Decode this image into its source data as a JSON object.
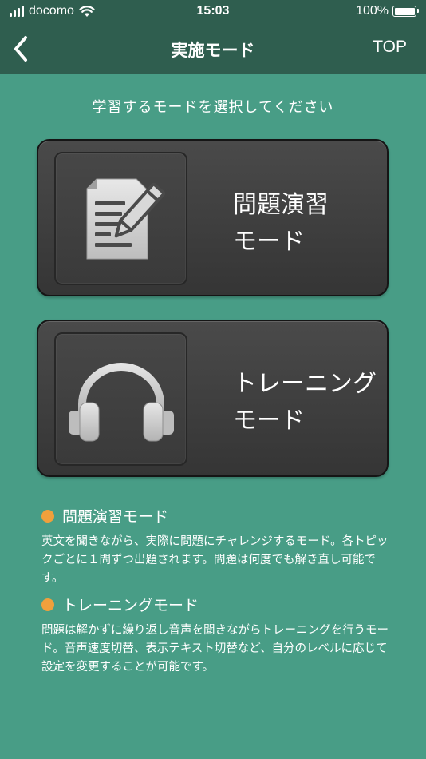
{
  "status_bar": {
    "carrier": "docomo",
    "time": "15:03",
    "battery_percent": "100%",
    "battery_level": 1.0
  },
  "nav": {
    "back_icon": "chevron-left-icon",
    "title": "実施モード",
    "top_label": "TOP"
  },
  "instruction": "学習するモードを選択してください",
  "modes": [
    {
      "icon": "document-pencil-icon",
      "line1": "問題演習",
      "line2": "モード"
    },
    {
      "icon": "headphones-icon",
      "line1": "トレーニング",
      "line2": "モード"
    }
  ],
  "descriptions": [
    {
      "title": "問題演習モード",
      "body": "英文を聞きながら、実際に問題にチャレンジするモード。各トピックごとに１問ずつ出題されます。問題は何度でも解き直し可能です。"
    },
    {
      "title": "トレーニングモード",
      "body": "問題は解かずに繰り返し音声を聞きながらトレーニングを行うモード。音声速度切替、表示テキスト切替など、自分のレベルに応じて設定を変更することが可能です。"
    }
  ],
  "colors": {
    "background": "#489d86",
    "bar": "#2f5e4f",
    "card": "#3d3d3d",
    "bullet": "#f0a03c"
  }
}
